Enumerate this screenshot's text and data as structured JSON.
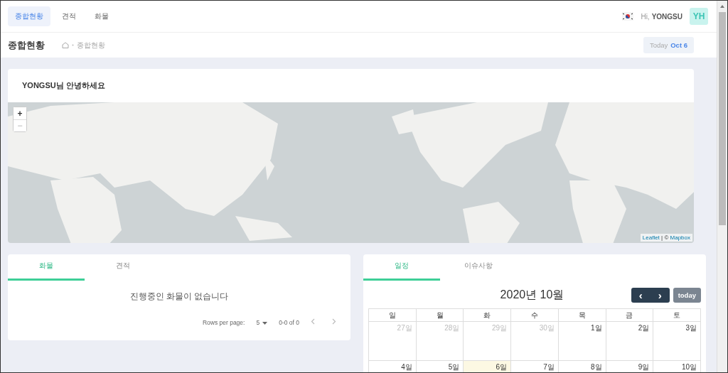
{
  "nav_tabs": [
    {
      "label": "종합현황",
      "selected": true
    },
    {
      "label": "견적",
      "selected": false
    },
    {
      "label": "화물",
      "selected": false
    }
  ],
  "user": {
    "greeting": "Hi,",
    "name": "YONGSU",
    "initials": "YH"
  },
  "page_header": {
    "title": "종합현황",
    "breadcrumb": "종합현황",
    "today_label": "Today",
    "today_date": "Oct 6"
  },
  "welcome": {
    "text": "YONGSU님 안녕하세요"
  },
  "map": {
    "zoom_in": "+",
    "zoom_out": "−",
    "attribution_links": [
      "Leaflet",
      "Mapbox"
    ],
    "attribution_separator": "|",
    "copyright": "©"
  },
  "cargo_panel": {
    "tabs": [
      {
        "label": "화물",
        "selected": true
      },
      {
        "label": "견적",
        "selected": false
      }
    ],
    "empty_message": "진행중인 화물이 없습니다",
    "rows_per_page_label": "Rows per page:",
    "rows_per_page": "5",
    "range": "0-0 of 0"
  },
  "calendar_panel": {
    "tabs": [
      {
        "label": "일정",
        "selected": true
      },
      {
        "label": "이슈사항",
        "selected": false
      }
    ],
    "title": "2020년 10월",
    "prev": "‹",
    "next": "›",
    "today_button": "today",
    "weekdays": [
      "일",
      "월",
      "화",
      "수",
      "목",
      "금",
      "토"
    ],
    "weeks": [
      [
        {
          "label": "27일",
          "outside": true,
          "today": false
        },
        {
          "label": "28일",
          "outside": true,
          "today": false
        },
        {
          "label": "29일",
          "outside": true,
          "today": false
        },
        {
          "label": "30일",
          "outside": true,
          "today": false
        },
        {
          "label": "1일",
          "outside": false,
          "today": false
        },
        {
          "label": "2일",
          "outside": false,
          "today": false
        },
        {
          "label": "3일",
          "outside": false,
          "today": false
        }
      ],
      [
        {
          "label": "4일",
          "outside": false,
          "today": false
        },
        {
          "label": "5일",
          "outside": false,
          "today": false
        },
        {
          "label": "6일",
          "outside": false,
          "today": true
        },
        {
          "label": "7일",
          "outside": false,
          "today": false
        },
        {
          "label": "8일",
          "outside": false,
          "today": false
        },
        {
          "label": "9일",
          "outside": false,
          "today": false
        },
        {
          "label": "10일",
          "outside": false,
          "today": false
        }
      ]
    ]
  }
}
